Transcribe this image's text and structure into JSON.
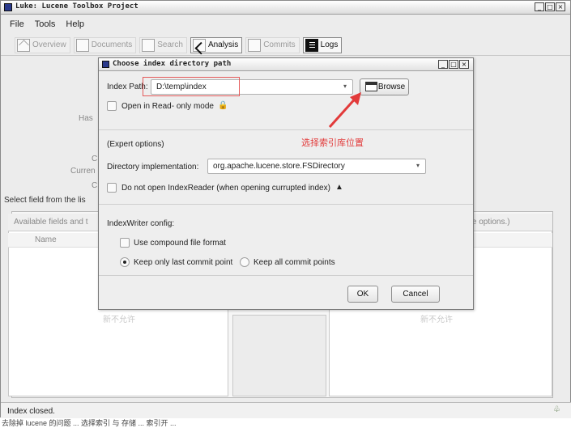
{
  "window": {
    "title": "Luke: Lucene Toolbox Project",
    "controls": [
      "_",
      "□",
      "×"
    ]
  },
  "menu": [
    "File",
    "Tools",
    "Help"
  ],
  "tabs": [
    {
      "label": "Overview",
      "icon": "home-icon",
      "active": false
    },
    {
      "label": "Documents",
      "icon": "document-icon",
      "active": false
    },
    {
      "label": "Search",
      "icon": "search-icon",
      "active": false
    },
    {
      "label": "Analysis",
      "icon": "analysis-icon",
      "active": true
    },
    {
      "label": "Commits",
      "icon": "commits-icon",
      "active": false
    },
    {
      "label": "Logs",
      "icon": "logs-icon",
      "active": true
    }
  ],
  "background": {
    "left_labels": [
      "Has",
      "C",
      "Curren",
      "C"
    ],
    "select_field_label": "Select field from the lis",
    "available_fields": "Available fields and t",
    "name_col": "Name",
    "right_head": "ore options.)",
    "ghost_left": "新不允许",
    "ghost_right": "新不允许"
  },
  "dialog": {
    "title": "Choose index directory path",
    "index_path_label": "Index Path:",
    "index_path_value": "D:\\temp\\index",
    "browse_label": "Browse",
    "readonly_label": "Open in Read- only mode",
    "lock_glyph": "🔒",
    "annotation": "选择索引库位置",
    "annotation_color": "#e23a3a",
    "expert_label": "(Expert options)",
    "dir_impl_label": "Directory implementation:",
    "dir_impl_value": "org.apache.lucene.store.FSDirectory",
    "no_reader_label": "Do not open IndexReader (when opening currupted index)",
    "warn_glyph": "▲",
    "writer_config_label": "IndexWriter config:",
    "compound_label": "Use compound file format",
    "keep_last_label": "Keep only last commit point",
    "keep_all_label": "Keep all commit points",
    "ok_label": "OK",
    "cancel_label": "Cancel"
  },
  "status": {
    "text": "Index closed.",
    "icon": "leaf-icon"
  },
  "bottom_text": "去除掉 lucene 的问题 ... 选择索引 与 存储 ... 索引开 ..."
}
